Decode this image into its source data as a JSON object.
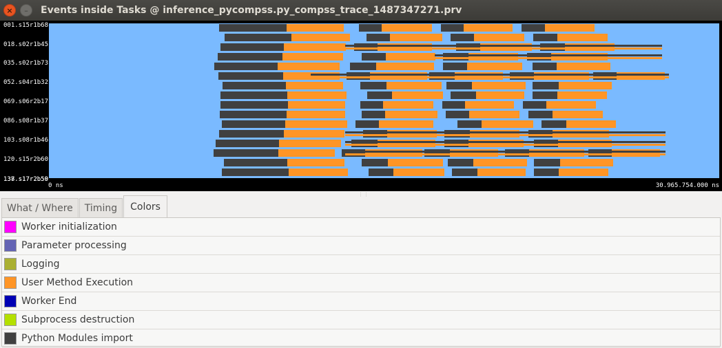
{
  "window": {
    "title": "Events inside Tasks @ inference_pycompss.py_compss_trace_1487347271.prv",
    "close_glyph": "×",
    "minimize_glyph": "–"
  },
  "timeline": {
    "row_labels": [
      "001.s15r1b68",
      "018.s02r1b45",
      "035.s02r1b73",
      "052.s04r1b32",
      "069.s06r2b17",
      "086.s08r1b37",
      "103.s08r1b46",
      "120.s15r2b60",
      "137.s17r2b50"
    ],
    "row_labels_overlap": "138.s17r2b59",
    "start_label": "0 ns",
    "end_label": "30.965.754.000 ns",
    "background_color": "#7abaff"
  },
  "tabs": [
    {
      "label": "What / Where",
      "active": false
    },
    {
      "label": "Timing",
      "active": false
    },
    {
      "label": "Colors",
      "active": true
    }
  ],
  "legend": [
    {
      "label": "Worker initialization",
      "color": "#ff00ff"
    },
    {
      "label": "Parameter processing",
      "color": "#6464b4"
    },
    {
      "label": "Logging",
      "color": "#aab032"
    },
    {
      "label": "User Method Execution",
      "color": "#ff9526"
    },
    {
      "label": "Worker End",
      "color": "#0000b4"
    },
    {
      "label": "Subprocess destruction",
      "color": "#b4e000"
    },
    {
      "label": "Python Modules import",
      "color": "#404040"
    }
  ]
}
